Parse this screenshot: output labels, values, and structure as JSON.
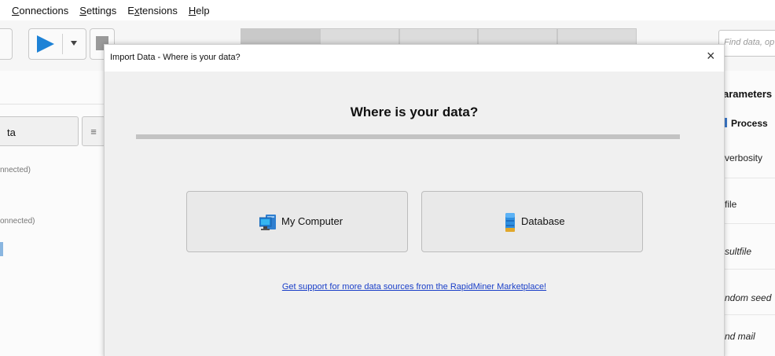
{
  "menubar": {
    "items": [
      {
        "mnemonic": "C",
        "rest": "onnections"
      },
      {
        "mnemonic": "S",
        "rest": "ettings"
      },
      {
        "pre": "E",
        "mnemonic": "x",
        "rest": "tensions"
      },
      {
        "mnemonic": "H",
        "rest": "elp"
      }
    ]
  },
  "toolbar": {
    "search_placeholder": "Find data, op"
  },
  "left_panel": {
    "tab_label": "ta",
    "menu_glyph": "≡",
    "status_1": "nnected)",
    "status_2": "onnected)"
  },
  "right_panel": {
    "title": "arameters",
    "process_label": "Process",
    "params": [
      "verbosity",
      "file",
      "sultfile",
      "ndom seed",
      "nd mail"
    ]
  },
  "dialog": {
    "title": "Import Data - Where is your data?",
    "close_glyph": "×",
    "heading": "Where is your data?",
    "sources": [
      {
        "label": "My Computer",
        "icon": "computer-icon"
      },
      {
        "label": "Database",
        "icon": "database-icon"
      }
    ],
    "marketplace_link": "Get support for more data sources from the RapidMiner Marketplace!"
  },
  "colors": {
    "run_blue": "#1e82d6",
    "link_blue": "#1a3fc8"
  }
}
